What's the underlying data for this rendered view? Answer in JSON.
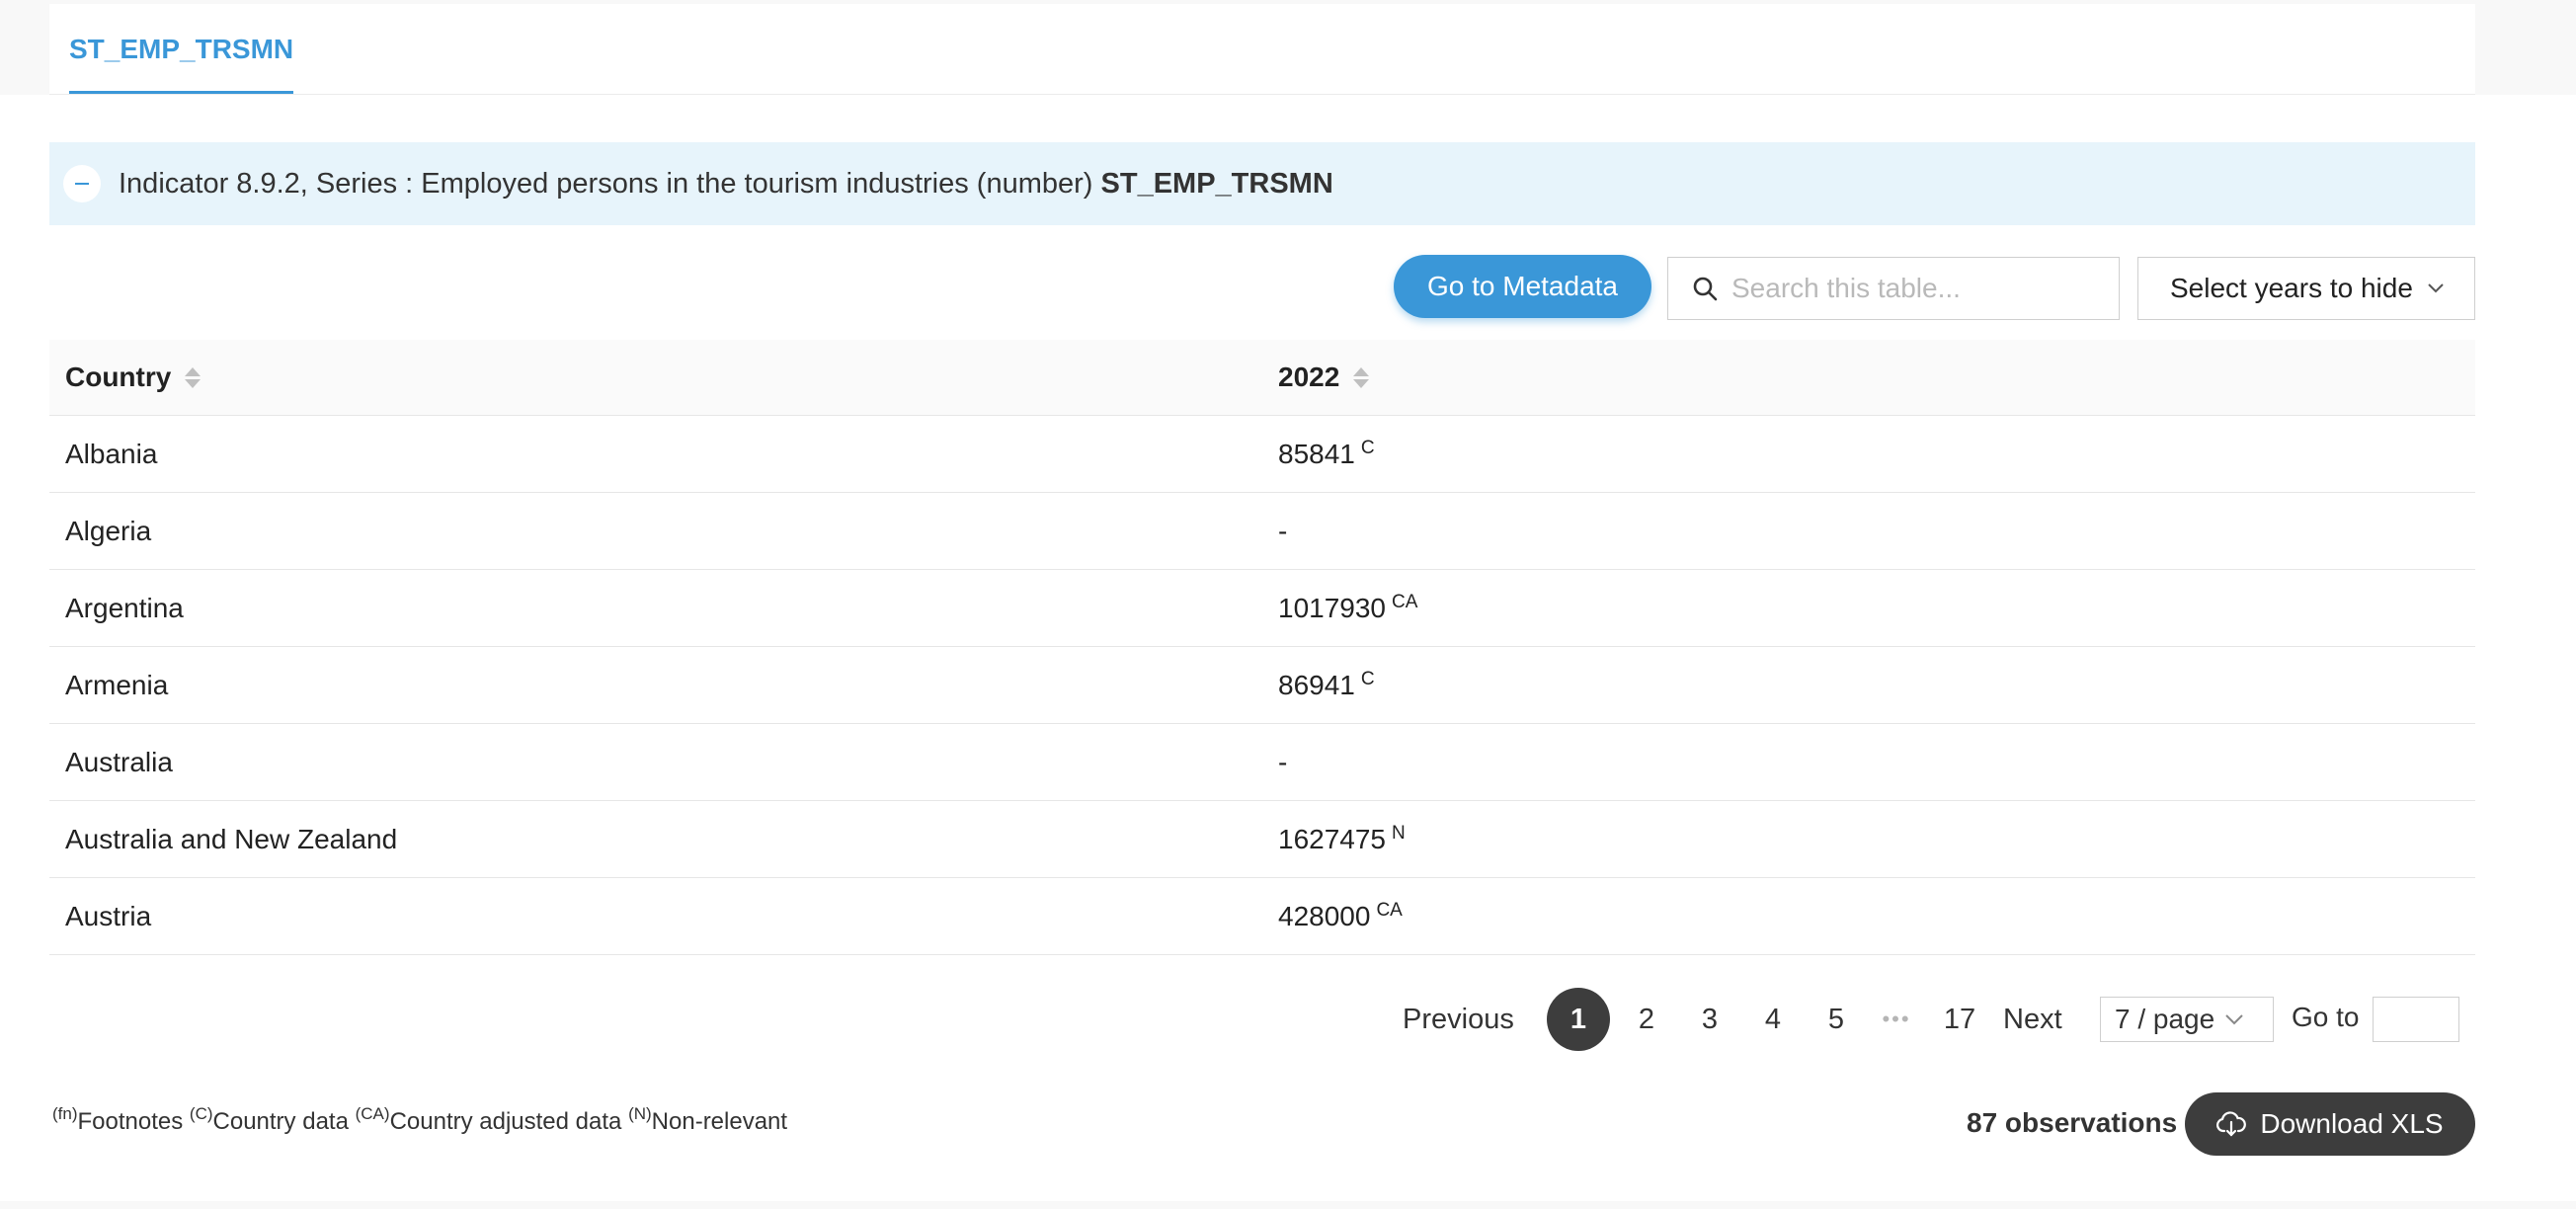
{
  "tab": {
    "label": "ST_EMP_TRSMN"
  },
  "indicator": {
    "text": "Indicator 8.9.2, Series : Employed persons in the tourism industries (number) ",
    "code": "ST_EMP_TRSMN"
  },
  "toolbar": {
    "metadata_label": "Go to Metadata",
    "search_placeholder": "Search this table...",
    "years_label": "Select years to hide"
  },
  "table": {
    "headers": [
      "Country",
      "2022"
    ],
    "rows": [
      {
        "country": "Albania",
        "value": "85841",
        "flag": "C"
      },
      {
        "country": "Algeria",
        "value": "-",
        "flag": ""
      },
      {
        "country": "Argentina",
        "value": "1017930",
        "flag": "CA"
      },
      {
        "country": "Armenia",
        "value": "86941",
        "flag": "C"
      },
      {
        "country": "Australia",
        "value": "-",
        "flag": ""
      },
      {
        "country": "Australia and New Zealand",
        "value": "1627475",
        "flag": "N"
      },
      {
        "country": "Austria",
        "value": "428000",
        "flag": "CA"
      }
    ]
  },
  "pagination": {
    "previous": "Previous",
    "pages": [
      "1",
      "2",
      "3",
      "4",
      "5"
    ],
    "ellipsis": "•••",
    "last": "17",
    "next": "Next",
    "page_size": "7 / page",
    "goto_label": "Go to",
    "current": "1"
  },
  "legend": {
    "fn_sup": "(fn)",
    "fn": "Footnotes",
    "c_sup": "(C)",
    "c": "Country data",
    "ca_sup": "(CA)",
    "ca": "Country adjusted data",
    "n_sup": "(N)",
    "n": "Non-relevant"
  },
  "footer": {
    "observations": "87 observations",
    "download_label": "Download XLS"
  },
  "colors": {
    "accent": "#3a97d8",
    "dark": "#3d3d3d",
    "indicator_bg": "#e7f4fb"
  }
}
